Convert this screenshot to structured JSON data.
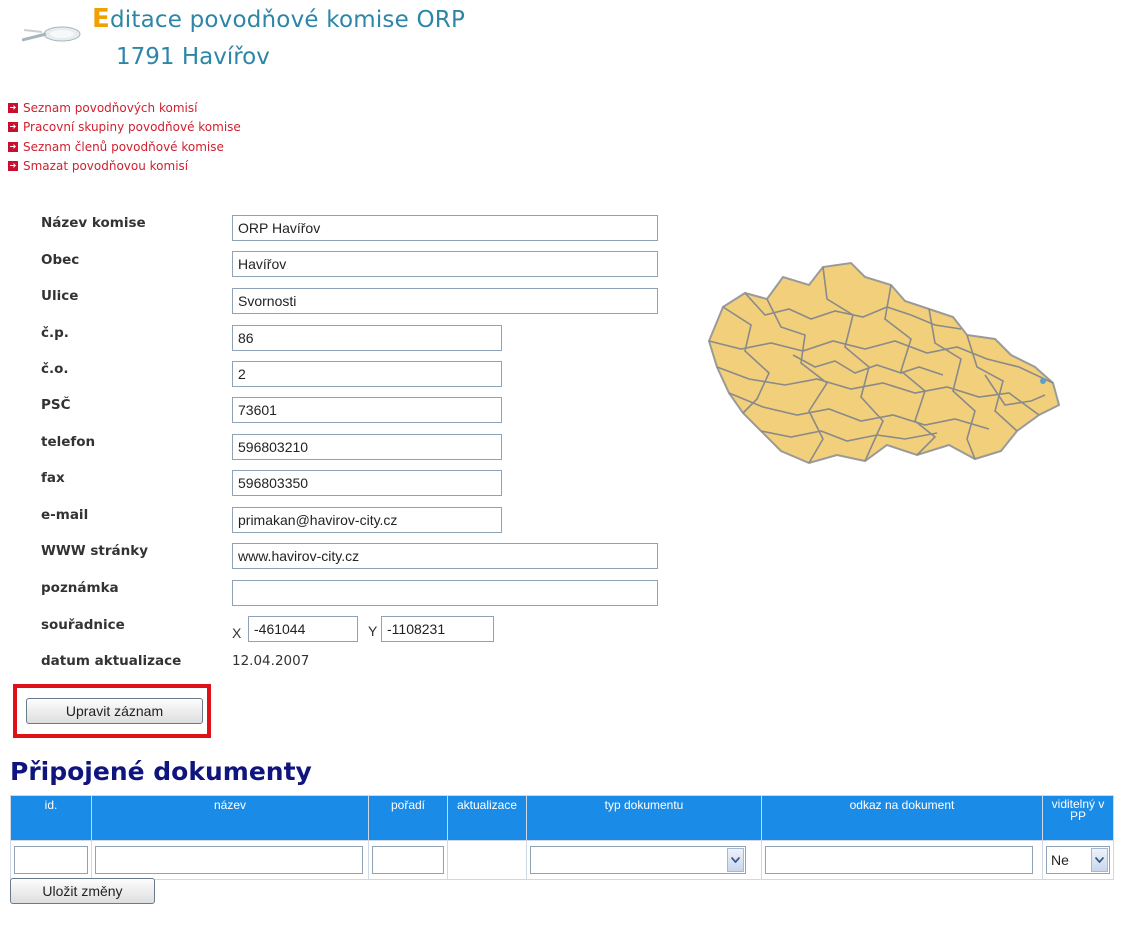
{
  "header": {
    "title_first_letter": "E",
    "title_rest": "ditace povodňové komise ORP",
    "subtitle": "1791 Havířov"
  },
  "nav": {
    "items": [
      {
        "label": "Seznam povodňových komisí"
      },
      {
        "label": "Pracovní skupiny povodňové komise"
      },
      {
        "label": "Seznam členů povodňové komise"
      },
      {
        "label": "Smazat povodňovou komisí"
      }
    ]
  },
  "form": {
    "nazev_label": "Název komise",
    "nazev_value": "ORP Havířov",
    "obec_label": "Obec",
    "obec_value": "Havířov",
    "ulice_label": "Ulice",
    "ulice_value": "Svornosti",
    "cp_label": "č.p.",
    "cp_value": "86",
    "co_label": "č.o.",
    "co_value": "2",
    "psc_label": "PSČ",
    "psc_value": "73601",
    "telefon_label": "telefon",
    "telefon_value": "596803210",
    "fax_label": "fax",
    "fax_value": "596803350",
    "email_label": "e-mail",
    "email_value": "primakan@havirov-city.cz",
    "www_label": "WWW stránky",
    "www_value": "www.havirov-city.cz",
    "poznamka_label": "poznámka",
    "poznamka_value": "",
    "souradnice_label": "souřadnice",
    "x_label": "X",
    "x_value": "-461044",
    "y_label": "Y",
    "y_value": "-1108231",
    "datum_label": "datum aktualizace",
    "datum_value": "12.04.2007",
    "save_record_label": "Upravit záznam"
  },
  "documents": {
    "title": "Připojené dokumenty",
    "columns": [
      "id.",
      "název",
      "pořadí",
      "aktualizace",
      "typ dokumentu",
      "odkaz na dokument",
      "viditelný v PP"
    ],
    "row": {
      "id": "",
      "nazev": "",
      "poradi": "",
      "aktualizace": "",
      "typ": "",
      "odkaz": "",
      "viditelny": "Ne"
    },
    "save_changes_label": "Uložit změny"
  },
  "colors": {
    "title": "#2d86a8",
    "title_accent": "#f0a000",
    "nav_link": "#d1202f",
    "table_header": "#1b8be8",
    "section_title": "#10157e",
    "highlight": "#e0101a",
    "map_fill": "#f2cf7a",
    "map_border": "#8a8a8a"
  },
  "icons": {
    "logo": "magnifier-logo-icon",
    "nav_bullet": "red-arrow-icon",
    "dropdown": "chevron-down-icon"
  }
}
